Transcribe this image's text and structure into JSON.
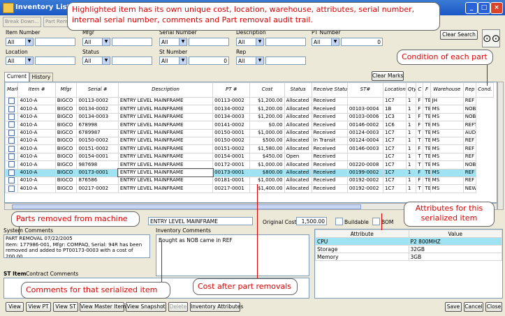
{
  "window": {
    "title": "Inventory List"
  },
  "toolbar": {
    "break_down": "Break Down...",
    "part_rem": "Part Rem"
  },
  "filters": {
    "item_number": {
      "label": "Item Number",
      "value": "All"
    },
    "mfgr": {
      "label": "Mfgr",
      "value": "All"
    },
    "serial_number": {
      "label": "Serial Number",
      "value": "All"
    },
    "description": {
      "label": "Description",
      "value": "All"
    },
    "pt_number": {
      "label": "PT Number",
      "value": "All",
      "count": "0"
    },
    "location": {
      "label": "Location",
      "value": "All"
    },
    "status": {
      "label": "Status",
      "value": "All"
    },
    "st_number": {
      "label": "St Number",
      "value": "All",
      "count": "0"
    },
    "rep": {
      "label": "Rep",
      "value": "All"
    },
    "clear_search": "Clear Search"
  },
  "tabs": {
    "current": "Current",
    "history": "History"
  },
  "clear_marks": "Clear Marks",
  "grid": {
    "columns": [
      "Mark",
      "Item #",
      "Mfgr",
      "Serial #",
      "Description",
      "PT #",
      "Cost",
      "Status",
      "Receive Status",
      "ST#",
      "Location",
      "Qty",
      "C",
      "F",
      "Warehouse",
      "Rep",
      "Cond."
    ],
    "rows": [
      [
        "",
        "4010-A",
        "BIGCO",
        "00113-0002",
        "ENTRY LEVEL MAINFRAME",
        "00113-0002",
        "$1,200.00",
        "Allocated",
        "Received",
        "",
        "1C7",
        "1",
        "F",
        "TECH-STOR",
        "JH",
        "REF"
      ],
      [
        "",
        "4010-A",
        "BIGCO",
        "00134-0002",
        "ENTRY LEVEL MAINFRAME",
        "00134-0002",
        "$1,200.00",
        "Allocated",
        "Received",
        "00103-0004",
        "1B",
        "1",
        "F",
        "TECH-STOR",
        "MS",
        "NOB"
      ],
      [
        "",
        "4010-A",
        "BIGCO",
        "00134-0003",
        "ENTRY LEVEL MAINFRAME",
        "00134-0003",
        "$1,200.00",
        "Allocated",
        "Received",
        "00103-0006",
        "1C3",
        "1",
        "F",
        "TECH-STOR",
        "MS",
        "NOB"
      ],
      [
        "",
        "4010-A",
        "BIGCO",
        "678998",
        "ENTRY LEVEL MAINFRAME",
        "00141-0002",
        "$0.00",
        "Allocated",
        "Received",
        "00146-0002",
        "1C6",
        "1",
        "F",
        "TECH-STOR",
        "MS",
        "REFT"
      ],
      [
        "",
        "4010-A",
        "BIGCO",
        "6789987",
        "ENTRY LEVEL MAINFRAME",
        "00150-0001",
        "$1,000.00",
        "Allocated",
        "Received",
        "00124-0003",
        "1C7",
        "1",
        "T",
        "TECH-STOR",
        "MS",
        "AUDT"
      ],
      [
        "",
        "4010-A",
        "BIGCO",
        "00150-0002",
        "ENTRY LEVEL MAINFRAME",
        "00150-0002",
        "$500.00",
        "Allocated",
        "In Transit",
        "00124-0004",
        "1C7",
        "1",
        "T",
        "TECH-STOR",
        "MS",
        "REF"
      ],
      [
        "",
        "4010-A",
        "BIGCO",
        "00151-0002",
        "ENTRY LEVEL MAINFRAME",
        "00151-0002",
        "$1,580.00",
        "Allocated",
        "Received",
        "00146-0003",
        "1C7",
        "1",
        "F",
        "TECH-STOR",
        "MS",
        "REF"
      ],
      [
        "",
        "4010-A",
        "BIGCO",
        "00154-0001",
        "ENTRY LEVEL MAINFRAME",
        "00154-0001",
        "$450.00",
        "Open",
        "Received",
        "",
        "1C7",
        "1",
        "T",
        "TECH-STOR",
        "MS",
        "REF"
      ],
      [
        "",
        "4010-A",
        "BIGCO",
        "987698",
        "ENTRY LEVEL MAINFRAME",
        "00172-0001",
        "$1,000.00",
        "Allocated",
        "Received",
        "00220-0008",
        "1C7",
        "1",
        "T",
        "TECH-STOR",
        "MS",
        "NOB"
      ],
      [
        "",
        "4010-A",
        "BIGCO",
        "00173-0001",
        "ENTRY LEVEL MAINFRAME",
        "00173-0001",
        "$800.00",
        "Allocated",
        "Received",
        "00199-0002",
        "1C7",
        "1",
        "F",
        "TECH-STOR",
        "MS",
        "REF"
      ],
      [
        "",
        "4010-A",
        "BIGCO",
        "876586",
        "ENTRY LEVEL MAINFRAME",
        "00181-0001",
        "$1,000.00",
        "Allocated",
        "Received",
        "00192-0002",
        "1C7",
        "1",
        "F",
        "TECH-STOR",
        "MS",
        "REF"
      ],
      [
        "",
        "4010-A",
        "BIGCO",
        "00217-0002",
        "ENTRY LEVEL MAINFRAME",
        "00217-0001",
        "$1,400.00",
        "Allocated",
        "Received",
        "00192-0002",
        "1C7",
        "1",
        "T",
        "TECH-STOR",
        "MS",
        "NEW"
      ]
    ],
    "selected_row": 9
  },
  "detail": {
    "description": "ENTRY LEVEL MAINFRAME",
    "original_cost_label": "Original Cost",
    "original_cost": "1,500.00",
    "buildable": "Buildable",
    "bom": "BOM",
    "system_comments_label": "System Comments",
    "system_comments": "PART REMOVAL 07/22/2005\nItem: 177986-001, Mfgr: COMPAQ, Serial: 94R has been removed and added to PT00173-0003 with a cost of 200.00",
    "inventory_comments_label": "Inventory Comments",
    "inventory_comments": "Bought as NOB came in REF",
    "st_item_label": "ST Item",
    "contract_comments_label": "Contract Comments",
    "attributes": {
      "headers": [
        "Attribute",
        "Value"
      ],
      "rows": [
        [
          "CPU",
          "P2 800MHZ"
        ],
        [
          "Storage",
          "32GB"
        ],
        [
          "Memory",
          "3GB"
        ]
      ]
    }
  },
  "buttons": {
    "view": "View",
    "view_pt": "View PT",
    "view_st": "View ST",
    "view_master_item": "View Master Item",
    "view_snapshot": "View Snapshot",
    "delete": "Delete",
    "inventory_attributes": "Inventory Attributes",
    "save": "Save",
    "cancel": "Cancel",
    "close": "Close"
  },
  "callouts": {
    "top": "Highlighted item has its own unique cost, location, warehouse, attributes, serial number, internal serial number, comments and Part removal audit trail.",
    "condition": "Condition of each part",
    "parts_removed": "Parts removed from machine",
    "attributes": "Attributes for this serialized item",
    "comments": "Comments for that serialized item",
    "cost": "Cost after part removals"
  },
  "colors": {
    "highlight_row": "#9fe3f3",
    "callout_text": "#dd0000",
    "titlebar": "#1b57c6"
  }
}
